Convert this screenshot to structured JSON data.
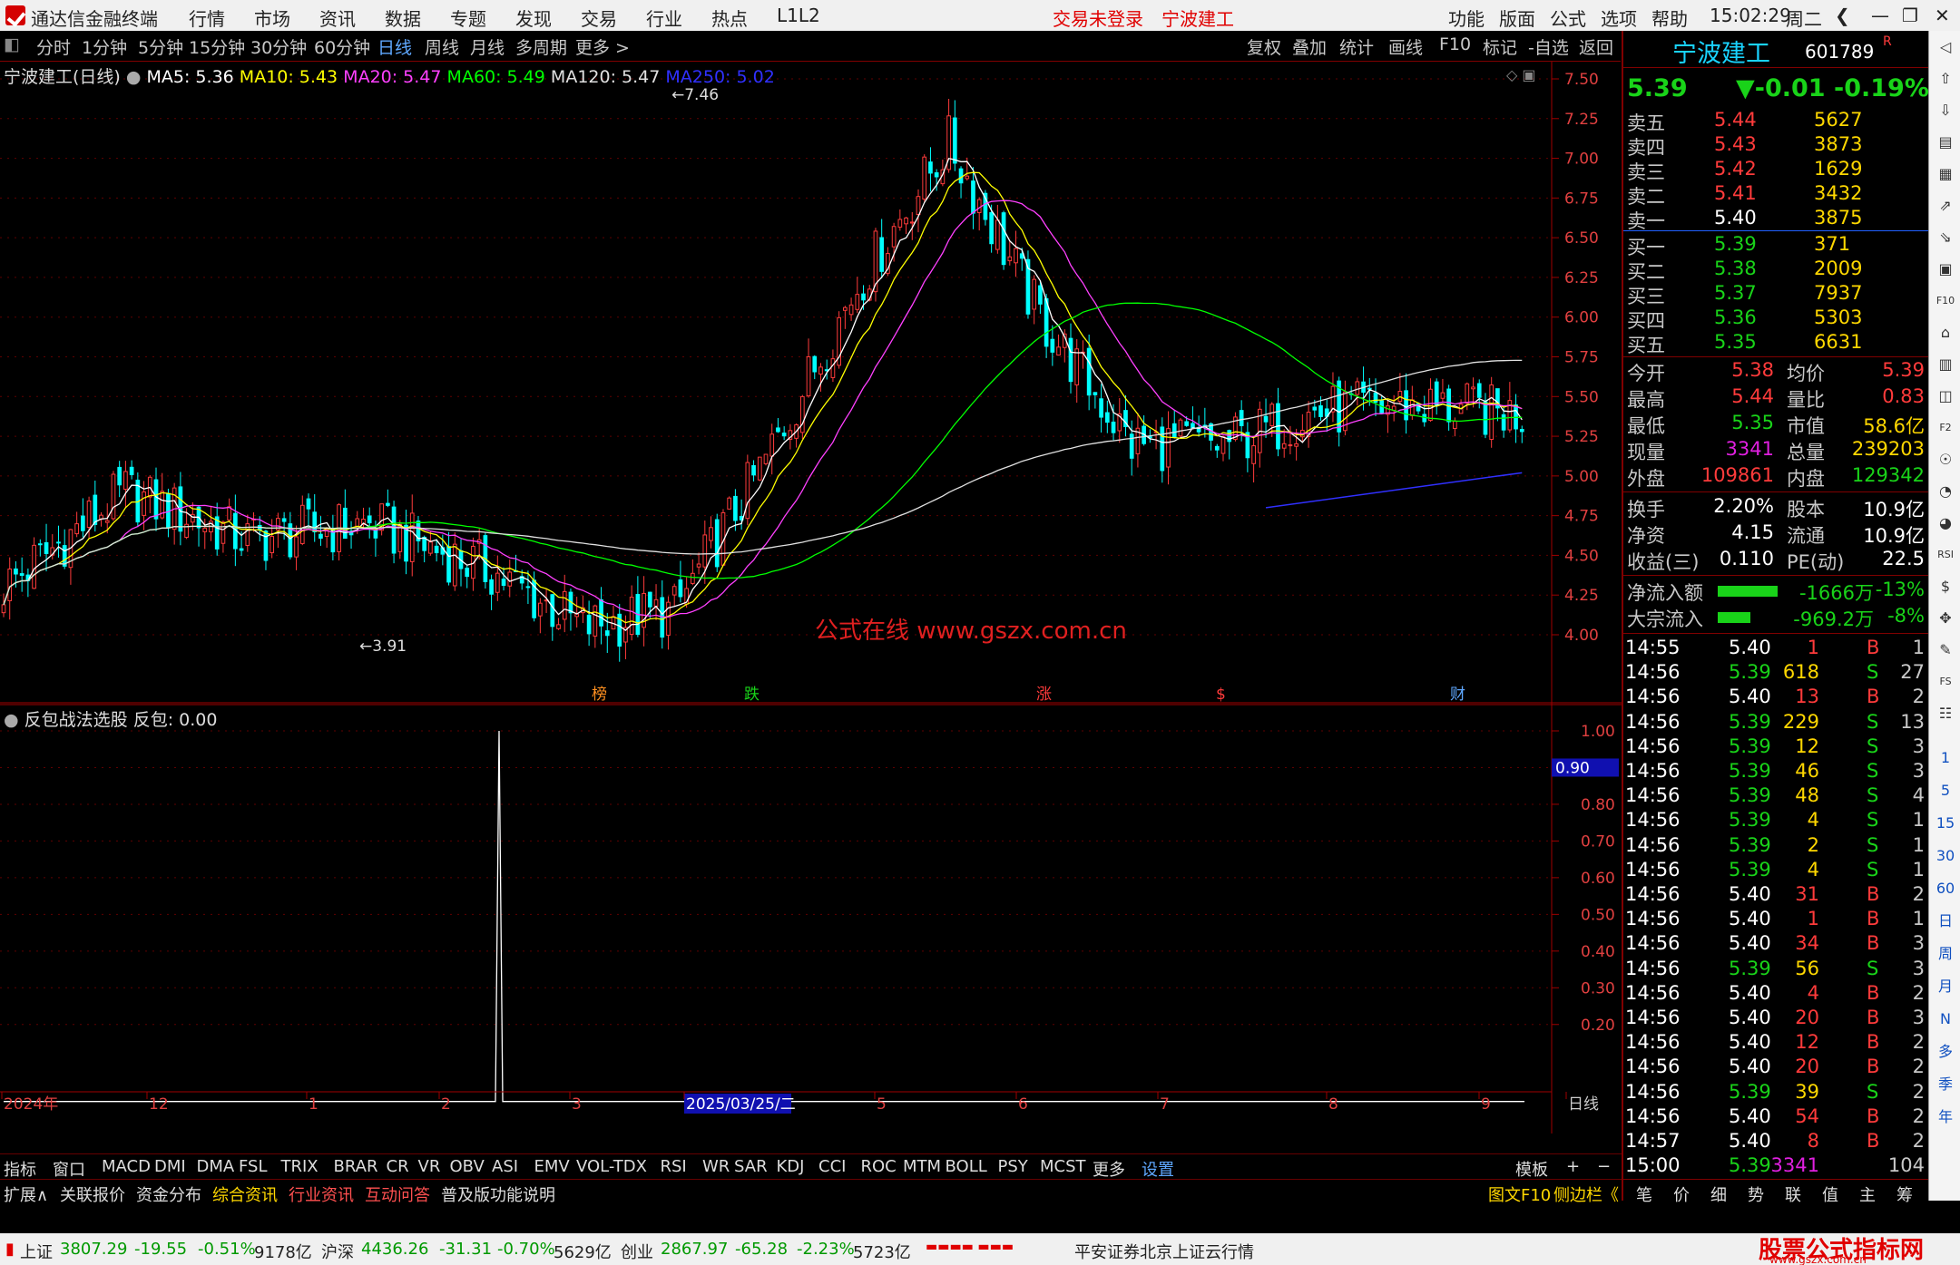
{
  "window": {
    "app_title": "通达信金融终端",
    "menu": [
      "行情",
      "市场",
      "资讯",
      "数据",
      "专题",
      "发现",
      "交易",
      "行业",
      "热点",
      "L1L2"
    ],
    "login_status": "交易未登录",
    "stock_name_top": "宁波建工",
    "right_menu": [
      "功能",
      "版面",
      "公式",
      "选项",
      "帮助"
    ],
    "time": "15:02:29",
    "weekday": "周二"
  },
  "toolbar": {
    "periods": [
      "分时",
      "1分钟",
      "5分钟",
      "15分钟",
      "30分钟",
      "60分钟",
      "日线",
      "周线",
      "月线",
      "多周期",
      "更多 >"
    ],
    "active_period": "日线",
    "right_buttons": [
      "复权",
      "叠加",
      "统计",
      "画线",
      "F10",
      "标记",
      "-自选",
      "返回"
    ]
  },
  "chart_header": {
    "title": "宁波建工(日线)",
    "ma5": "MA5: 5.36",
    "ma10": "MA10: 5.43",
    "ma20": "MA20: 5.47",
    "ma60": "MA60: 5.49",
    "ma120": "MA120: 5.47",
    "ma250": "MA250: 5.02"
  },
  "colors": {
    "ma5": "#ffffff",
    "ma10": "#ffff00",
    "ma20": "#ff40ff",
    "ma60": "#00ff00",
    "ma120": "#e0e0e0",
    "ma250": "#3030ff",
    "up": "#ff3b3b",
    "down": "#00ffff",
    "grid": "#800000"
  },
  "chart_data": {
    "type": "candlestick",
    "price_axis_ticks": [
      "7.50",
      "7.25",
      "7.00",
      "6.75",
      "6.50",
      "6.25",
      "6.00",
      "5.75",
      "5.50",
      "5.25",
      "5.00",
      "4.75",
      "4.50",
      "4.25",
      "4.00"
    ],
    "ylim": [
      3.8,
      7.6
    ],
    "high_label": "7.46",
    "low_label": "3.91",
    "time_axis_labels": [
      "2024年",
      "12",
      "1",
      "2",
      "3",
      "2025/03/25/二",
      "5",
      "6",
      "7",
      "8",
      "9",
      "日线"
    ],
    "event_markers": [
      "榜",
      "跌",
      "涨",
      "$",
      "财"
    ],
    "watermark": "公式在线   www.gszx.com.cn"
  },
  "indicator": {
    "title": "反包战法选股",
    "value_label": "反包: 0.00",
    "axis_ticks": [
      "1.00",
      "0.90",
      "0.80",
      "0.70",
      "0.60",
      "0.50",
      "0.40",
      "0.30",
      "0.20"
    ],
    "highlight_value": "0.90",
    "spike": 1.0
  },
  "indicator_tabs": [
    "指标",
    "窗口",
    "MACD",
    "DMI",
    "DMA",
    "FSL",
    "TRIX",
    "BRAR",
    "CR",
    "VR",
    "OBV",
    "ASI",
    "EMV",
    "VOL-TDX",
    "RSI",
    "WR",
    "SAR",
    "KDJ",
    "CCI",
    "ROC",
    "MTM",
    "BOLL",
    "PSY",
    "MCST",
    "更多",
    "设置"
  ],
  "indicator_tabs_right": [
    "模板",
    "+",
    "−"
  ],
  "bottom_tabs": [
    "扩展∧",
    "关联报价",
    "资金分布",
    "综合资讯",
    "行业资讯",
    "互动问答",
    "普及版功能说明"
  ],
  "bottom_tabs_right": [
    "图文F10",
    "侧边栏《"
  ],
  "quote": {
    "name": "宁波建工",
    "code": "601789",
    "flag": "R",
    "price": "5.39",
    "change": "▼-0.01",
    "pct": "-0.19%",
    "asks": [
      {
        "label": "卖五",
        "price": "5.44",
        "vol": "5627"
      },
      {
        "label": "卖四",
        "price": "5.43",
        "vol": "3873"
      },
      {
        "label": "卖三",
        "price": "5.42",
        "vol": "1629"
      },
      {
        "label": "卖二",
        "price": "5.41",
        "vol": "3432"
      },
      {
        "label": "卖一",
        "price": "5.40",
        "vol": "3875"
      }
    ],
    "bids": [
      {
        "label": "买一",
        "price": "5.39",
        "vol": "371"
      },
      {
        "label": "买二",
        "price": "5.38",
        "vol": "2009"
      },
      {
        "label": "买三",
        "price": "5.37",
        "vol": "7937"
      },
      {
        "label": "买四",
        "price": "5.36",
        "vol": "5303"
      },
      {
        "label": "买五",
        "price": "5.35",
        "vol": "6631"
      }
    ],
    "stats": [
      {
        "l1": "今开",
        "v1": "5.38",
        "l2": "均价",
        "v2": "5.39"
      },
      {
        "l1": "最高",
        "v1": "5.44",
        "l2": "量比",
        "v2": "0.83"
      },
      {
        "l1": "最低",
        "v1": "5.35",
        "l2": "市值",
        "v2": "58.6亿"
      },
      {
        "l1": "现量",
        "v1": "3341",
        "l2": "总量",
        "v2": "239203"
      },
      {
        "l1": "外盘",
        "v1": "109861",
        "l2": "内盘",
        "v2": "129342"
      }
    ],
    "stats2": [
      {
        "l1": "换手",
        "v1": "2.20%",
        "l2": "股本",
        "v2": "10.9亿"
      },
      {
        "l1": "净资",
        "v1": "4.15",
        "l2": "流通",
        "v2": "10.9亿"
      },
      {
        "l1": "收益(三)",
        "v1": "0.110",
        "l2": "PE(动)",
        "v2": "22.5"
      }
    ],
    "flows": [
      {
        "label": "净流入额",
        "value": "-1666万",
        "pct": "-13%"
      },
      {
        "label": "大宗流入",
        "value": "-969.2万",
        "pct": "-8%"
      }
    ],
    "ticks": [
      {
        "t": "14:55",
        "p": "5.40",
        "v": "1",
        "s": "B",
        "n": "1"
      },
      {
        "t": "14:56",
        "p": "5.39",
        "v": "618",
        "s": "S",
        "n": "27"
      },
      {
        "t": "14:56",
        "p": "5.40",
        "v": "13",
        "s": "B",
        "n": "2"
      },
      {
        "t": "14:56",
        "p": "5.39",
        "v": "229",
        "s": "S",
        "n": "13"
      },
      {
        "t": "14:56",
        "p": "5.39",
        "v": "12",
        "s": "S",
        "n": "3"
      },
      {
        "t": "14:56",
        "p": "5.39",
        "v": "46",
        "s": "S",
        "n": "3"
      },
      {
        "t": "14:56",
        "p": "5.39",
        "v": "48",
        "s": "S",
        "n": "4"
      },
      {
        "t": "14:56",
        "p": "5.39",
        "v": "4",
        "s": "S",
        "n": "1"
      },
      {
        "t": "14:56",
        "p": "5.39",
        "v": "2",
        "s": "S",
        "n": "1"
      },
      {
        "t": "14:56",
        "p": "5.39",
        "v": "4",
        "s": "S",
        "n": "1"
      },
      {
        "t": "14:56",
        "p": "5.40",
        "v": "31",
        "s": "B",
        "n": "2"
      },
      {
        "t": "14:56",
        "p": "5.40",
        "v": "1",
        "s": "B",
        "n": "1"
      },
      {
        "t": "14:56",
        "p": "5.40",
        "v": "34",
        "s": "B",
        "n": "3"
      },
      {
        "t": "14:56",
        "p": "5.39",
        "v": "56",
        "s": "S",
        "n": "3"
      },
      {
        "t": "14:56",
        "p": "5.40",
        "v": "4",
        "s": "B",
        "n": "2"
      },
      {
        "t": "14:56",
        "p": "5.40",
        "v": "20",
        "s": "B",
        "n": "3"
      },
      {
        "t": "14:56",
        "p": "5.40",
        "v": "12",
        "s": "B",
        "n": "2"
      },
      {
        "t": "14:56",
        "p": "5.40",
        "v": "20",
        "s": "B",
        "n": "2"
      },
      {
        "t": "14:56",
        "p": "5.39",
        "v": "39",
        "s": "S",
        "n": "2"
      },
      {
        "t": "14:56",
        "p": "5.40",
        "v": "54",
        "s": "B",
        "n": "2"
      },
      {
        "t": "14:57",
        "p": "5.40",
        "v": "8",
        "s": "B",
        "n": "2"
      },
      {
        "t": "15:00",
        "p": "5.39",
        "v": "3341",
        "s": "",
        "n": "104"
      }
    ],
    "bottom_tabs": [
      "笔",
      "价",
      "细",
      "势",
      "联",
      "值",
      "主",
      "筹"
    ]
  },
  "sidebar_labels": [
    "1",
    "5",
    "15",
    "30",
    "60",
    "日",
    "周",
    "月",
    "N",
    "多",
    "季",
    "年"
  ],
  "status_bar": {
    "sh_label": "上证",
    "sh_val": "3807.29",
    "sh_chg": "-19.55",
    "sh_pct": "-0.51%",
    "sh_amt": "9178亿",
    "sz_label": "沪深",
    "sz_val": "4436.26",
    "sz_chg": "-31.31",
    "sz_pct": "-0.70%",
    "sz_amt": "5629亿",
    "cy_label": "创业",
    "cy_val": "2867.97",
    "cy_chg": "-65.28",
    "cy_pct": "-2.23%",
    "cy_amt": "5723亿",
    "broker": "平安证券北京上证云行情",
    "site_logo": "股票公式指标网",
    "site_url": "www.gszx.com.cn"
  }
}
